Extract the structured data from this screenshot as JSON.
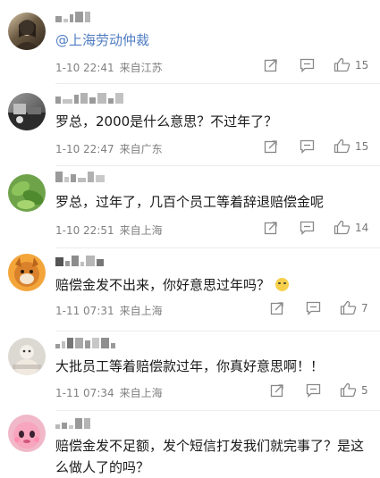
{
  "comments": [
    {
      "mention": "@上海劳动仲裁",
      "text": "",
      "time": "1-10 22:41",
      "location": "来自江苏",
      "likes": "15",
      "avatar_icon": "user-avatar-icon"
    },
    {
      "text": "罗总，2000是什么意思？不过年了？",
      "time": "1-10 22:47",
      "location": "来自广东",
      "likes": "15",
      "avatar_icon": "user-avatar-icon"
    },
    {
      "text": "罗总，过年了，几百个员工等着辞退赔偿金呢",
      "time": "1-10 22:51",
      "location": "来自上海",
      "likes": "14",
      "avatar_icon": "user-avatar-icon"
    },
    {
      "text": "赔偿金发不出来，你好意思过年吗？",
      "time": "1-11 07:31",
      "location": "来自上海",
      "likes": "7",
      "avatar_icon": "user-avatar-icon"
    },
    {
      "text": "大批员工等着赔偿款过年，你真好意思啊！！",
      "time": "1-11 07:34",
      "location": "来自上海",
      "likes": "5",
      "avatar_icon": "user-avatar-icon"
    },
    {
      "text": "赔偿金发不足额，发个短信打发我们就完事了？是这么做人了的吗？",
      "avatar_icon": "user-avatar-icon"
    }
  ],
  "icons": {
    "repost": "repost-icon",
    "comment": "comment-icon",
    "like": "like-icon"
  },
  "colors": {
    "mention": "#4f7cc2",
    "meta": "#808080",
    "text": "#1a1a1a"
  }
}
